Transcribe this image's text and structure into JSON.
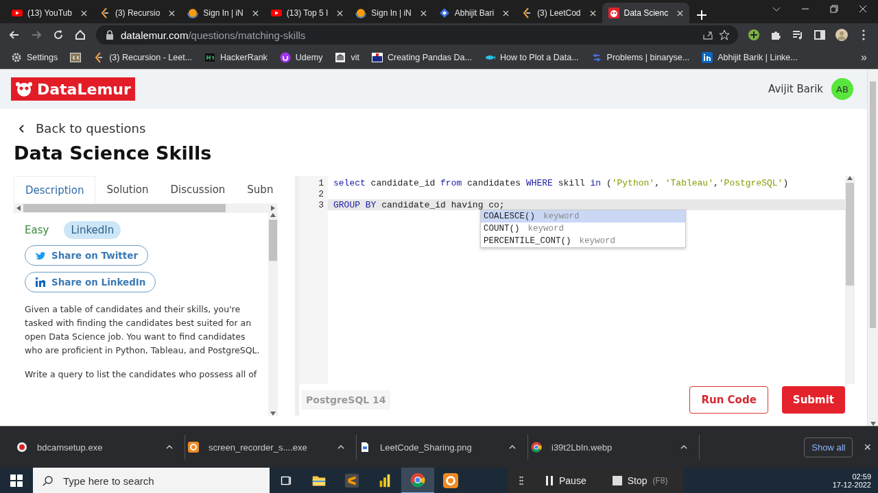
{
  "browser": {
    "tabs": [
      {
        "title": "(13) YouTub",
        "kind": "youtube",
        "selected": false
      },
      {
        "title": "(3) Recursio",
        "kind": "leet",
        "selected": false
      },
      {
        "title": "Sign In | iN",
        "kind": "orb",
        "selected": false
      },
      {
        "title": "(13) Top 5 I",
        "kind": "youtube",
        "selected": false
      },
      {
        "title": "Sign In | iN",
        "kind": "orb",
        "selected": false
      },
      {
        "title": "Abhijit Bari",
        "kind": "diamond",
        "selected": false
      },
      {
        "title": "(3) LeetCod",
        "kind": "leet",
        "selected": false
      },
      {
        "title": "Data Scienc",
        "kind": "lemur",
        "selected": true
      }
    ],
    "url_host": "datalemur.com",
    "url_path": "/questions/matching-skills",
    "bookmarks": [
      {
        "label": "Settings",
        "kind": "gear"
      },
      {
        "kind": "cc"
      },
      {
        "label": "(3) Recursion - Leet...",
        "kind": "leet"
      },
      {
        "label": "HackerRank",
        "kind": "hackerrank"
      },
      {
        "label": "Udemy",
        "kind": "udemy"
      },
      {
        "label": "vit",
        "kind": "vit"
      },
      {
        "label": "Creating Pandas Da...",
        "kind": "p2n"
      },
      {
        "label": "How to Plot a Data...",
        "kind": "fish"
      },
      {
        "label": "Problems | binaryse...",
        "kind": "binary"
      },
      {
        "label": "Abhijit Barik | Linke...",
        "kind": "linkedin"
      }
    ],
    "more_bookmarks": "»"
  },
  "site": {
    "logo": "DataLemur",
    "user_name": "Avijit Barik",
    "avatar_initials": "AB"
  },
  "question": {
    "back_link": "Back to questions",
    "title": "Data Science Skills",
    "tabs": [
      {
        "label": "Description",
        "selected": true
      },
      {
        "label": "Solution",
        "selected": false
      },
      {
        "label": "Discussion",
        "selected": false
      },
      {
        "label": "Subn",
        "selected": false
      }
    ],
    "difficulty": "Easy",
    "company": "LinkedIn",
    "share_buttons": [
      {
        "label": "Share on Twitter",
        "kind": "twitter"
      },
      {
        "label": "Share on LinkedIn",
        "kind": "linkedin"
      }
    ],
    "paragraphs": [
      "Given a table of candidates and their skills, you're tasked with finding the candidates best suited for an open Data Science job. You want to find candidates who are proficient in Python, Tableau, and PostgreSQL.",
      "Write a query to list the candidates who possess all of"
    ]
  },
  "editor": {
    "lines": [
      {
        "number": "1",
        "current": false,
        "tokens": [
          {
            "kind": "kw",
            "text": "select"
          },
          {
            "kind": "plain",
            "text": " candidate_id "
          },
          {
            "kind": "kw",
            "text": "from"
          },
          {
            "kind": "plain",
            "text": " candidates "
          },
          {
            "kind": "kw",
            "text": "WHERE"
          },
          {
            "kind": "plain",
            "text": " skill "
          },
          {
            "kind": "kw",
            "text": "in"
          },
          {
            "kind": "plain",
            "text": " ("
          },
          {
            "kind": "str",
            "text": "'Python'"
          },
          {
            "kind": "plain",
            "text": ", "
          },
          {
            "kind": "str",
            "text": "'Tableau'"
          },
          {
            "kind": "plain",
            "text": ","
          },
          {
            "kind": "str",
            "text": "'PostgreSQL'"
          },
          {
            "kind": "plain",
            "text": ")"
          }
        ]
      },
      {
        "number": "2",
        "current": false
      },
      {
        "number": "3",
        "current": true,
        "tokens": [
          {
            "kind": "kw",
            "text": "GROUP BY"
          },
          {
            "kind": "plain",
            "text": " candidate_id having co;"
          }
        ]
      }
    ],
    "suggestions": [
      {
        "name": "COALESCE()",
        "hint": "keyword",
        "selected": true
      },
      {
        "name": "COUNT()",
        "hint": "keyword",
        "selected": false
      },
      {
        "name": "PERCENTILE_CONT()",
        "hint": "keyword",
        "selected": false
      }
    ],
    "dialect": "PostgreSQL 14",
    "run_button": "Run Code",
    "submit_button": "Submit"
  },
  "downloads": {
    "items": [
      {
        "name": "bdcamsetup.exe",
        "kind": "bdcam"
      },
      {
        "name": "screen_recorder_s....exe",
        "kind": "recorder"
      },
      {
        "name": "LeetCode_Sharing.png",
        "kind": "file"
      },
      {
        "name": "i39t2LbIn.webp",
        "kind": "chrome"
      }
    ],
    "show_all": "Show all",
    "close": "×"
  },
  "taskbar": {
    "search_placeholder": "Type here to search",
    "apps": [
      {
        "kind": "folder",
        "active": false
      },
      {
        "kind": "sublime",
        "active": false
      },
      {
        "kind": "powerbi",
        "active": false
      },
      {
        "kind": "chrome",
        "active": true
      },
      {
        "kind": "recorder",
        "active": false
      }
    ],
    "recorder_controls": [
      {
        "label": "Pause",
        "kind": "pause"
      },
      {
        "label": "Stop",
        "shortcut": "(F8)",
        "kind": "stop"
      }
    ],
    "time": "02:59",
    "date": "17-12-2022"
  }
}
